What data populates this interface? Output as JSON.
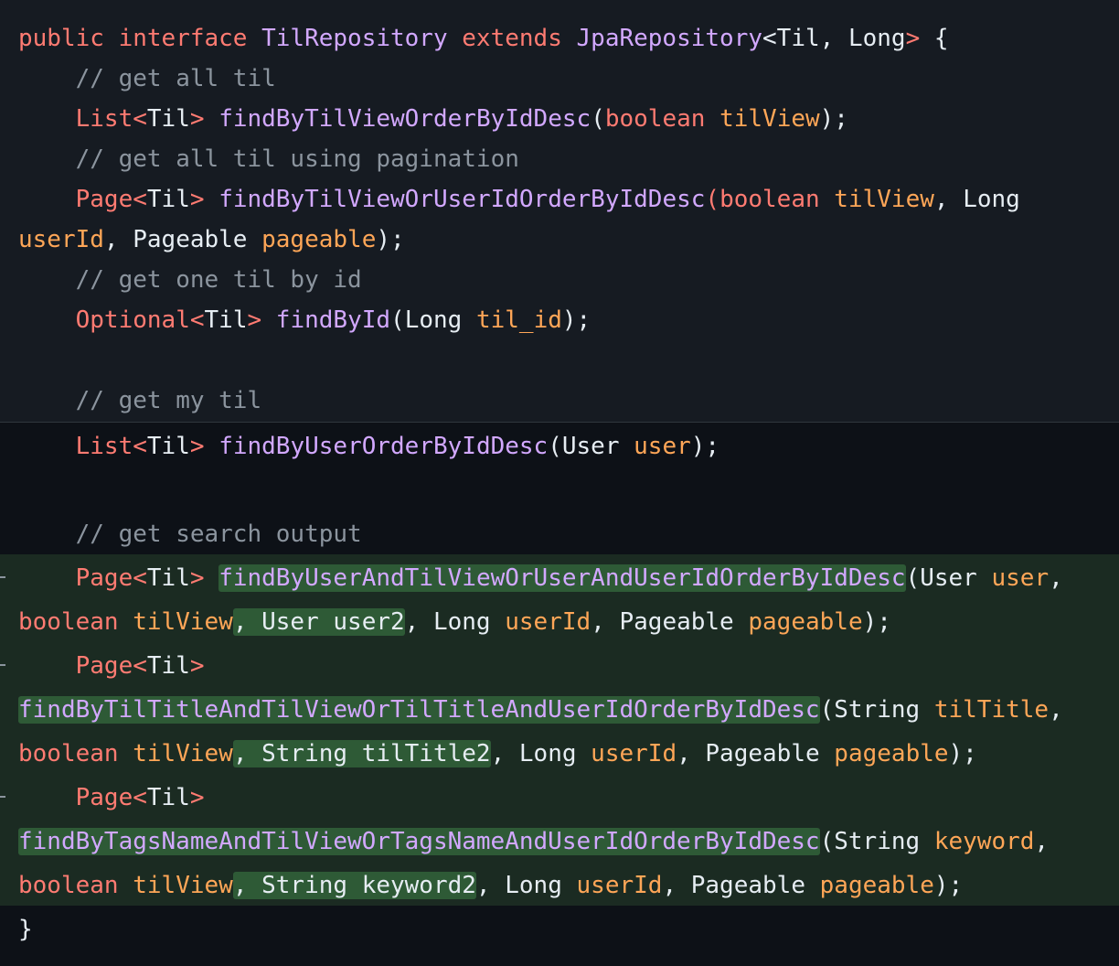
{
  "code": {
    "t": {
      "public": "public",
      "interface": "interface",
      "repo_name": "TilRepository",
      "extends": "extends",
      "jpa": "JpaRepository",
      "lt": "<",
      "gt": ">",
      "til": "Til",
      "comma_sp": ", ",
      "long": "Long",
      "open_brace": " {",
      "indent": "    ",
      "list": "List",
      "page": "Page",
      "optional": "Optional",
      "boolean": "boolean",
      "user_type": "User",
      "string": "String",
      "pageable_type": "Pageable",
      "open_paren": "(",
      "close_stmt": ");",
      "close_brace": "}",
      "sp": " ",
      "comma": ","
    },
    "comments": {
      "c1": "// get all til",
      "c2": "// get all til using pagination",
      "c3": "// get one til by id",
      "c4": "// get my til",
      "c5": "// get search output"
    },
    "methods": {
      "m1": "findByTilViewOrderByIdDesc",
      "m2": "findByTilViewOrUserIdOrderByIdDesc",
      "m3": "findById",
      "m4": "findByUserOrderByIdDesc",
      "m5": "findByUserAndTilViewOrUserAndUserIdOrderByIdDesc",
      "m6": "findByTilTitleAndTilViewOrTilTitleAndUserIdOrderByIdDesc",
      "m7": "findByTagsNameAndTilViewOrTagsNameAndUserIdOrderByIdDesc"
    },
    "params": {
      "tilView": "tilView",
      "userId": "userId",
      "pageable": "pageable",
      "til_id": "til_id",
      "user": "user",
      "tilTitle": "tilTitle",
      "keyword": "keyword"
    },
    "added_fragments": {
      "user2": ", User user2",
      "tilTitle2": ", String tilTitle2",
      "keyword2": ", String keyword2"
    }
  }
}
